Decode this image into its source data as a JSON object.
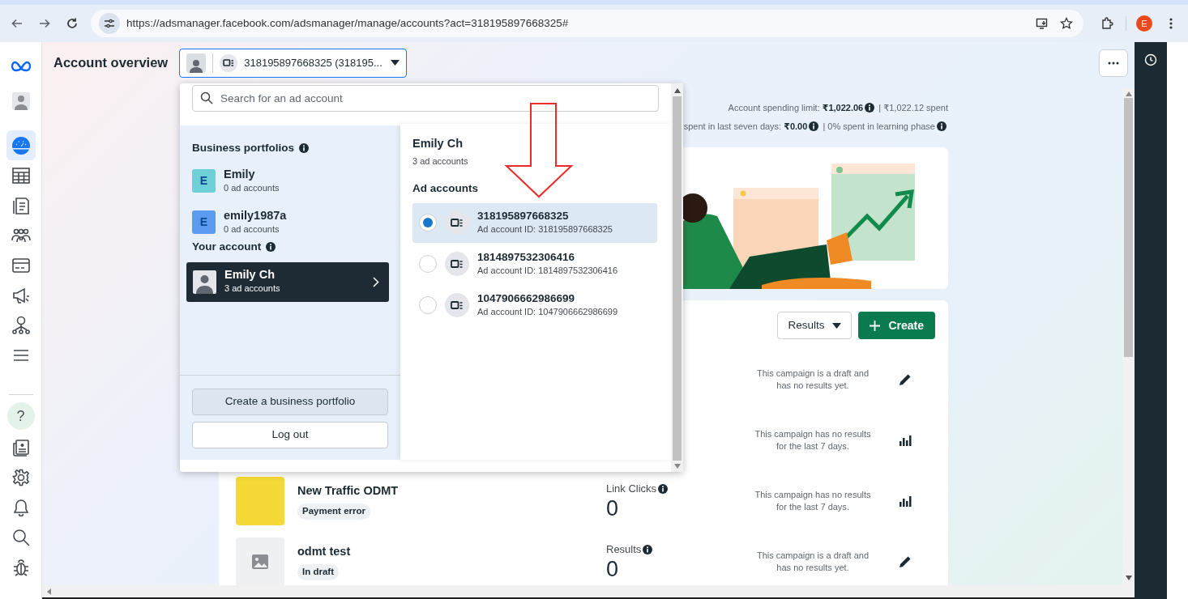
{
  "browser": {
    "url": "https://adsmanager.facebook.com/adsmanager/manage/accounts?act=318195897668325#",
    "profile_initial": "E"
  },
  "sidebar": {
    "items": [
      {
        "kind": "logo",
        "selected": false
      },
      {
        "kind": "avatar",
        "selected": false
      },
      {
        "kind": "dashboard",
        "selected": true
      },
      {
        "kind": "table",
        "selected": false
      },
      {
        "kind": "pages",
        "selected": false
      },
      {
        "kind": "audiences",
        "selected": false
      },
      {
        "kind": "billing",
        "selected": false
      },
      {
        "kind": "ads",
        "selected": false
      },
      {
        "kind": "hierarchy",
        "selected": false
      },
      {
        "kind": "menu",
        "selected": false
      },
      {
        "kind": "help",
        "label": "?",
        "selected": false
      },
      {
        "kind": "news",
        "selected": false
      },
      {
        "kind": "gear",
        "selected": false
      },
      {
        "kind": "bell",
        "selected": false
      },
      {
        "kind": "search",
        "selected": false
      },
      {
        "kind": "bug",
        "selected": false
      }
    ]
  },
  "header": {
    "title": "Account overview",
    "account_selector": "318195897668325 (318195..."
  },
  "stats": [
    [
      {
        "text": "Account spending limit: **₹1,022.06**",
        "info": true
      },
      {
        "text": "| ₹1,022.12 spent",
        "info": false
      }
    ],
    [
      {
        "text": "spent in last seven days: **₹0.00**",
        "info": true
      },
      {
        "text": "| 0% spent in learning phase",
        "info": true
      }
    ]
  ],
  "campaigns": {
    "sort_label": "Results",
    "create_label": "Create",
    "rows": [
      {
        "description": "This campaign is a draft and has no results yet.",
        "action": {
          "kind": "edit"
        }
      },
      {
        "description": "This campaign has no results for the last 7 days.",
        "action": {
          "kind": "insights"
        }
      },
      {
        "thumbnail": {
          "kind": "ad_image"
        },
        "name": "New Traffic ODMT",
        "status": "Payment error",
        "metric_label": "Link Clicks",
        "metric_info": true,
        "metric_value": "0",
        "description": "This campaign has no results for the last 7 days.",
        "action": {
          "kind": "insights"
        }
      },
      {
        "thumbnail": {
          "kind": "empty"
        },
        "name": "odmt test",
        "status": "In draft",
        "metric_label": "Results",
        "metric_info": true,
        "metric_value": "0",
        "description": "This campaign is a draft and has no results yet.",
        "action": {
          "kind": "edit"
        }
      }
    ]
  },
  "dropdown": {
    "search": {
      "placeholder": "Search for an ad account"
    },
    "portfolios_heading": "Business portfolios",
    "portfolios": [
      {
        "initial": "E",
        "name": "Emily",
        "count": "0 ad accounts",
        "color": "#6fd0d8"
      },
      {
        "initial": "E",
        "name": "emily1987a",
        "count": "0 ad accounts",
        "color": "#5b9cf0"
      }
    ],
    "your_account_heading": "Your account",
    "your_account": {
      "name": "Emily Ch",
      "count": "3 ad accounts",
      "selected": true
    },
    "buttons": [
      {
        "label": "Create a business portfolio",
        "kind": "secondary"
      },
      {
        "label": "Log out",
        "kind": "outline"
      }
    ],
    "detail": {
      "name": "Emily Ch",
      "count": "3 ad accounts",
      "heading": "Ad accounts",
      "accounts": [
        {
          "name": "318195897668325",
          "id_label": "Ad account ID: 318195897668325",
          "selected": true
        },
        {
          "name": "1814897532306416",
          "id_label": "Ad account ID: 1814897532306416",
          "selected": false
        },
        {
          "name": "1047906662986699",
          "id_label": "Ad account ID: 1047906662986699",
          "selected": false
        }
      ]
    }
  }
}
